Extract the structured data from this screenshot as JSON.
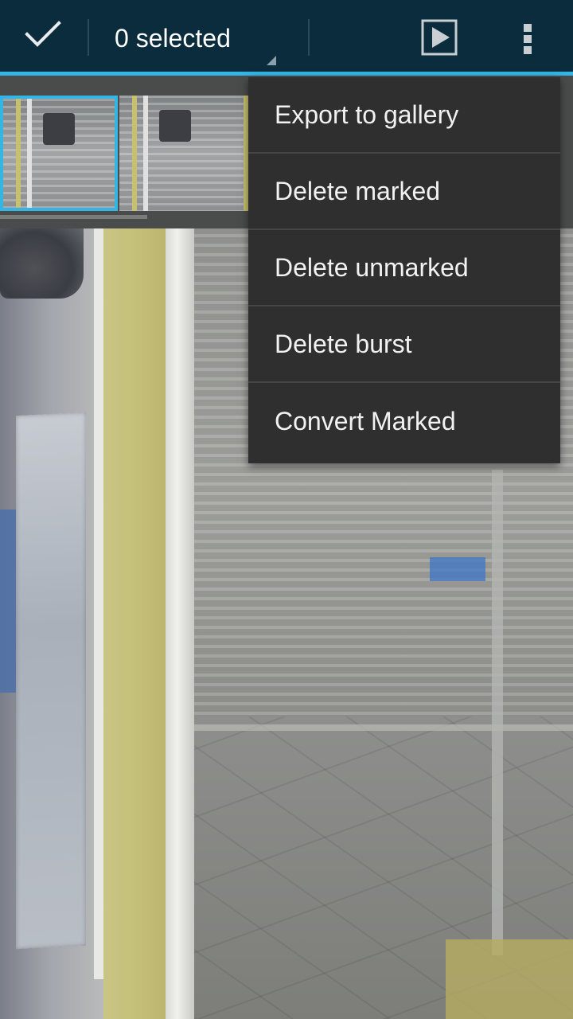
{
  "actionbar": {
    "title": "0 selected",
    "done_icon": "checkmark-icon",
    "play_icon": "play-icon",
    "overflow_icon": "overflow-menu-icon",
    "background_color": "#0a2c3d",
    "accent_color": "#33b5e5"
  },
  "thumbnails": [
    {
      "selected": true
    },
    {
      "selected": false
    },
    {
      "selected": false
    }
  ],
  "menu": {
    "items": [
      {
        "label": "Export to gallery"
      },
      {
        "label": "Delete marked"
      },
      {
        "label": "Delete unmarked"
      },
      {
        "label": "Delete burst"
      },
      {
        "label": "Convert Marked"
      }
    ],
    "background_color": "#2f2f2f"
  }
}
